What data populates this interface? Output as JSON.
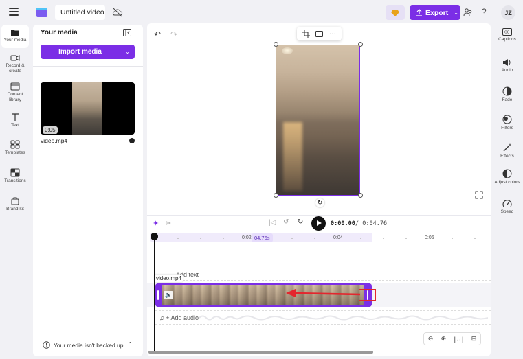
{
  "topbar": {
    "title": "Untitled video",
    "export_label": "Export",
    "avatar_initials": "JZ",
    "help": "?"
  },
  "leftnav": [
    {
      "label": "Your media",
      "icon": "folder-icon"
    },
    {
      "label": "Record & create",
      "icon": "camera-icon"
    },
    {
      "label": "Content library",
      "icon": "library-icon"
    },
    {
      "label": "Text",
      "icon": "text-icon"
    },
    {
      "label": "Templates",
      "icon": "templates-icon"
    },
    {
      "label": "Transitions",
      "icon": "transitions-icon"
    },
    {
      "label": "Brand kit",
      "icon": "brand-kit-icon"
    }
  ],
  "media": {
    "title": "Your media",
    "import_label": "Import media",
    "item_name": "video.mp4",
    "item_duration": "0:05",
    "backup_text": "Your media isn't backed up"
  },
  "player": {
    "current_time": "0:00.00",
    "total_time": "/ 0:04.76"
  },
  "ruler": {
    "marks": [
      "0:02",
      "0:04",
      "0:06"
    ],
    "badge": "04.76s"
  },
  "tracks": {
    "add_text": "Add text",
    "add_audio": "+ Add audio",
    "clip_name": "video.mp4"
  },
  "rightbar": [
    {
      "label": "Captions",
      "icon": "captions-icon"
    },
    {
      "label": "Audio",
      "icon": "speaker-icon"
    },
    {
      "label": "Fade",
      "icon": "fade-icon"
    },
    {
      "label": "Filters",
      "icon": "filters-icon"
    },
    {
      "label": "Effects",
      "icon": "effects-icon"
    },
    {
      "label": "Adjust colors",
      "icon": "adjust-colors-icon"
    },
    {
      "label": "Speed",
      "icon": "speedometer-icon"
    }
  ],
  "colors": {
    "accent": "#7b2ee6",
    "annotation": "#e3262e"
  }
}
